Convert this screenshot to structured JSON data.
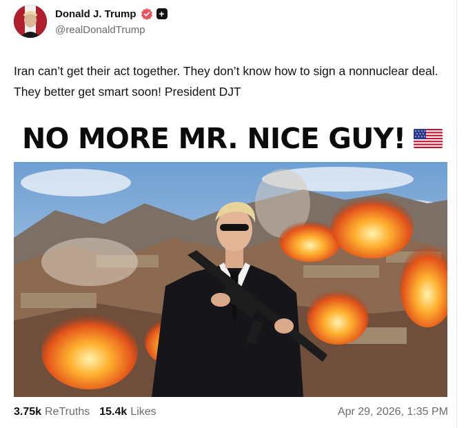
{
  "author": {
    "display_name": "Donald J. Trump",
    "handle": "@realDonaldTrump",
    "verified_icon": "verified-badge-icon",
    "plus_badge_label": "+"
  },
  "post": {
    "text": "Iran can’t get their act together. They don’t know how to sign a nonnuclear deal. They better get smart soon! President DJT",
    "image_headline": "NO MORE MR. NICE GUY!"
  },
  "stats": {
    "retruths_count": "3.75k",
    "retruths_label": "ReTruths",
    "likes_count": "15.4k",
    "likes_label": "Likes"
  },
  "timestamp": "Apr 29, 2026, 1:35 PM",
  "colors": {
    "verified": "#e8515e",
    "text": "#111111",
    "muted": "#6b6b6b",
    "flag_red": "#c8102e",
    "flag_blue": "#2a3b8f"
  }
}
